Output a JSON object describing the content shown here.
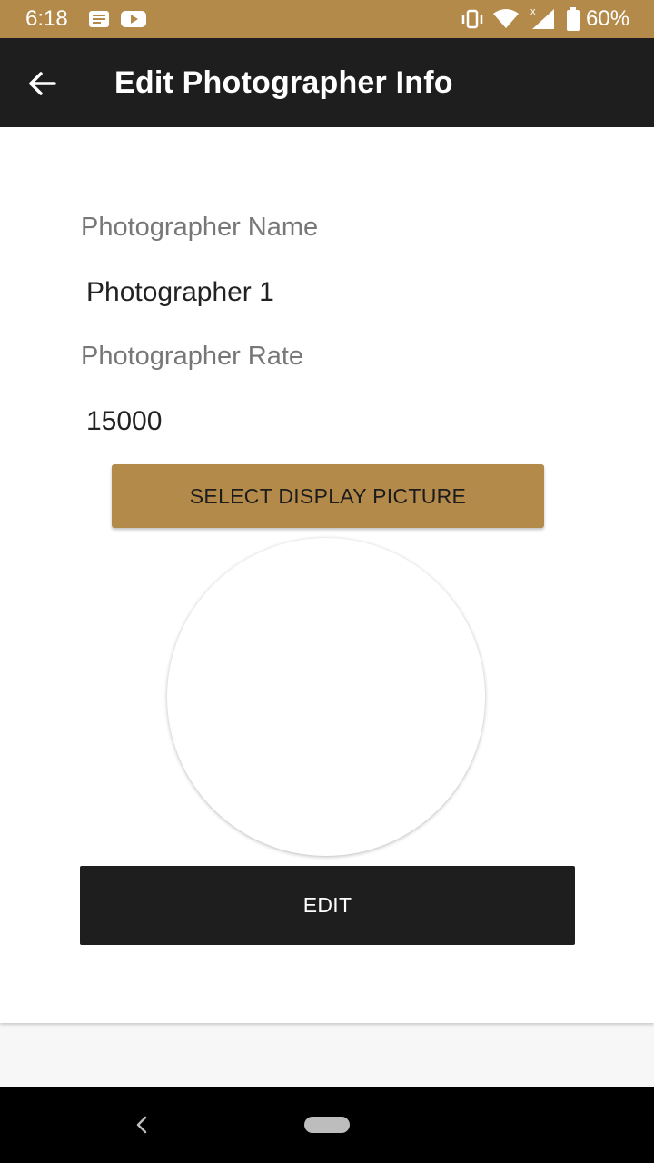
{
  "status_bar": {
    "time": "6:18",
    "battery": "60%",
    "notification_icons": [
      "message-icon",
      "youtube-icon"
    ],
    "system_icons": [
      "vibrate-icon",
      "wifi-icon",
      "signal-icon",
      "battery-icon"
    ]
  },
  "app_bar": {
    "title": "Edit Photographer Info",
    "back_icon": "arrow-left-icon"
  },
  "form": {
    "name_label": "Photographer Name",
    "name_value": "Photographer 1",
    "rate_label": "Photographer Rate",
    "rate_value": "15000",
    "select_picture_label": "SELECT DISPLAY PICTURE",
    "edit_label": "EDIT"
  },
  "nav_bar": {
    "back_icon": "chevron-left-icon",
    "home_icon": "home-pill-icon"
  },
  "colors": {
    "accent": "#b48a4a",
    "dark": "#1e1e1e",
    "background": "#f7f7f7"
  }
}
